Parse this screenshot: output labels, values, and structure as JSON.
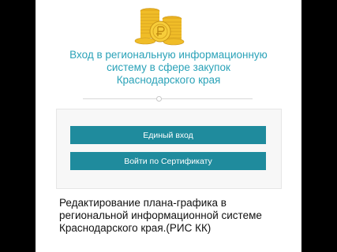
{
  "header": {
    "title_lines": [
      "Вход в региональную информационную",
      "систему в сфере закупок",
      "Краснодарского края"
    ]
  },
  "login": {
    "single_sign_on_label": "Единый вход",
    "certificate_label": "Войти по Сертификату"
  },
  "caption": {
    "lines": [
      "Редактирование плана-графика в",
      "региональной информационной системе",
      "Краснодарского края.(РИС КК)"
    ]
  },
  "colors": {
    "accent": "#1f8b9d",
    "title": "#2aa2b8",
    "coin": "#f2c230"
  },
  "icons": {
    "logo": "coins-stack-icon"
  }
}
